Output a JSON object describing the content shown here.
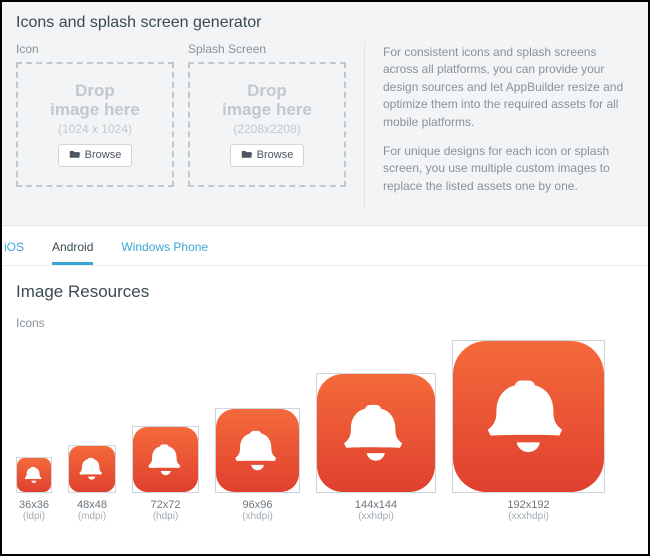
{
  "generator": {
    "title": "Icons and splash screen generator",
    "icon": {
      "label": "Icon",
      "drop_line1": "Drop",
      "drop_line2": "image here",
      "dims": "(1024 x 1024)",
      "browse": "Browse"
    },
    "splash": {
      "label": "Splash Screen",
      "drop_line1": "Drop",
      "drop_line2": "image here",
      "dims": "(2208x2208)",
      "browse": "Browse"
    },
    "desc_p1": "For consistent icons and splash screens across all platforms, you can provide your design sources and let AppBuilder resize and optimize them into the required assets for all mobile platforms.",
    "desc_p2": "For unique designs for each icon or splash screen, you use multiple custom images to replace the listed assets one by one."
  },
  "tabs": {
    "ios": "iOS",
    "android": "Android",
    "windows": "Windows Phone"
  },
  "resources": {
    "title": "Image Resources",
    "icons_label": "Icons",
    "items": [
      {
        "size": "36x36",
        "density": "(ldpi)"
      },
      {
        "size": "48x48",
        "density": "(mdpi)"
      },
      {
        "size": "72x72",
        "density": "(hdpi)"
      },
      {
        "size": "96x96",
        "density": "(xhdpi)"
      },
      {
        "size": "144x144",
        "density": "(xxhdpi)"
      },
      {
        "size": "192x192",
        "density": "(xxxhdpi)"
      }
    ]
  }
}
